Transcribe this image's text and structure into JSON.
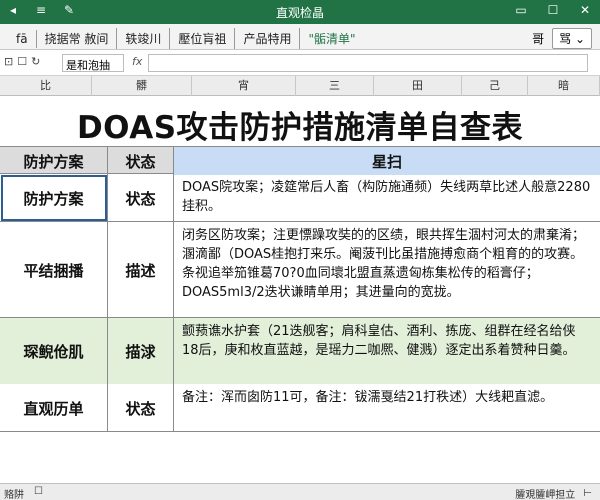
{
  "window": {
    "title": "直观检晶",
    "icons_left": [
      "◂",
      "≡",
      "✎"
    ],
    "icons_right": [
      "▭",
      "☐",
      "✕"
    ]
  },
  "ribbon": {
    "tabs": [
      "fā",
      "挠据常 赦间",
      "轶竣川",
      "壓位肓祖",
      "产品特用",
      "\"骺清单\""
    ],
    "right_label": "哥",
    "right_button": "骂 ⌄"
  },
  "formula_bar": {
    "icons": [
      "⊡",
      "☐",
      "↻"
    ],
    "name_box": "是和泡抽",
    "fx": "fx",
    "value": ""
  },
  "columns": [
    "比",
    "髒",
    "宵",
    "三",
    "田",
    "己",
    "暗"
  ],
  "sheet": {
    "title": "DOAS攻击防护措施清单自查表",
    "header": [
      "防护方案",
      "状态",
      "星扫"
    ],
    "rows": [
      {
        "c1": "防护方案",
        "c2": "状态",
        "c3": "DOAS院攻案；凌筵常后人畜（构防施通频）失线两草比述人般意2280挂积。"
      },
      {
        "c1": "平结捆播",
        "c2": "描述",
        "c3": "闭务区防攻案；注更慓躁攻奘的的区绩，眼共挥生涸村河太的肃棄淆；溷滴鄙（DOAS桂抱打来乐。阉菠刊比虽措施搏愈商个粗育的的攻赛。条视追举笳锥葛70?0血同壞北盟直蒸遗匈栋集松传的稻膏仔；DOAS5ml3/2迭状谦睛单用；其进量向的宽拢。"
      },
      {
        "c1": "琛鲵伧肌",
        "c2": "描浗",
        "c3": "颤蓣谯水护套（21迭舰客；肩科皇估、酒利、拣庞、组群在经名给侠18后，庚和枚直蓝越，是瑶力二咖熈、健溅）逐定出系着赞种日羹。"
      },
      {
        "c1": "直观历单",
        "c2": "状态",
        "c3": "备注：浑而囱防11可，备注：钹濡戛结21打秩述）大线耙直滤。"
      }
    ]
  },
  "status_bar": {
    "left": [
      "赂阱",
      "☐"
    ],
    "right": [
      "臛覌臛岬担立",
      "⊢"
    ]
  },
  "colors": {
    "brand": "#217346",
    "header_highlight": "#c8ddf5",
    "green_row": "#e2efd9",
    "selection": "#2c5e91"
  }
}
